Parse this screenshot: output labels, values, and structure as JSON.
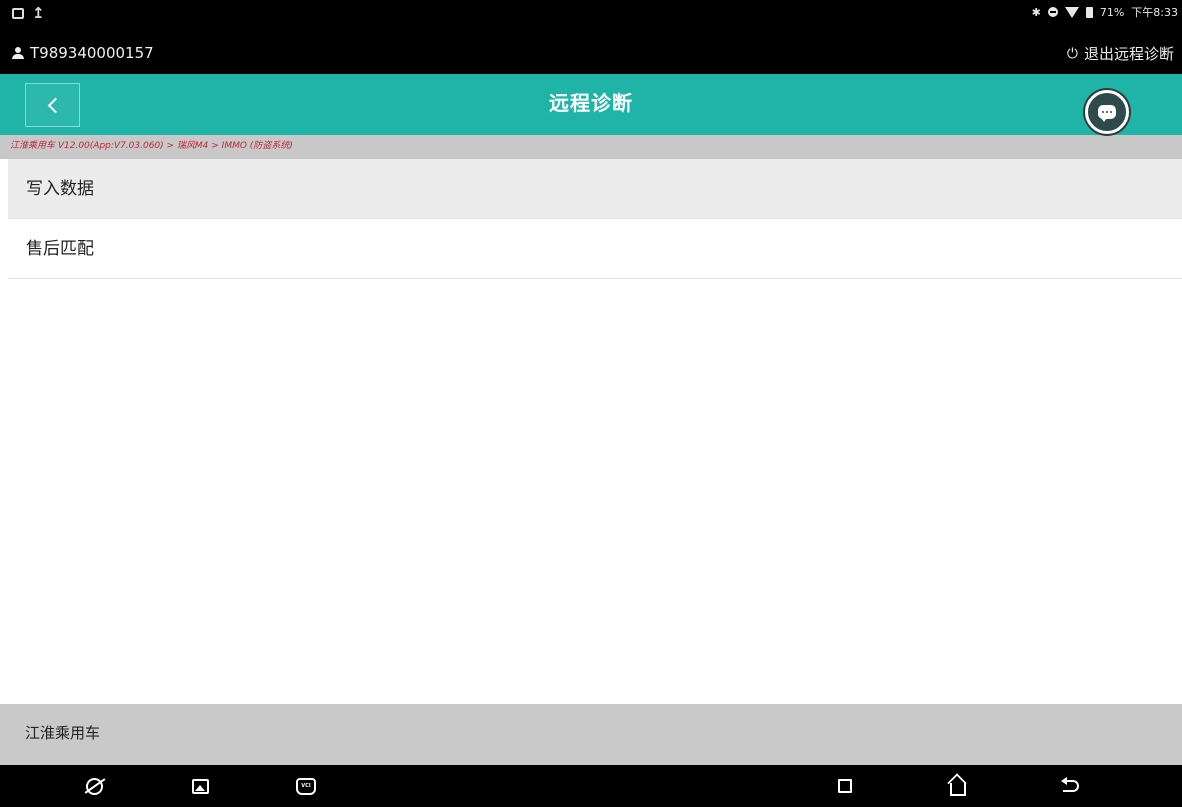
{
  "status_bar": {
    "battery": "71%",
    "time": "下午8:33",
    "user_id": "T989340000157",
    "exit_label": "退出远程诊断"
  },
  "header": {
    "title": "远程诊断"
  },
  "breadcrumb": "江淮乘用车 V12.00(App:V7.03.060) > 瑞风M4 > IMMO (防盗系统)",
  "menu": {
    "items": [
      {
        "label": "写入数据"
      },
      {
        "label": "售后匹配"
      }
    ]
  },
  "footer": {
    "label": "江淮乘用车"
  },
  "nav_bar": {
    "vci_label": "VCI"
  },
  "colors": {
    "accent": "#20b4a8",
    "breadcrumb_text": "#c3263c"
  }
}
